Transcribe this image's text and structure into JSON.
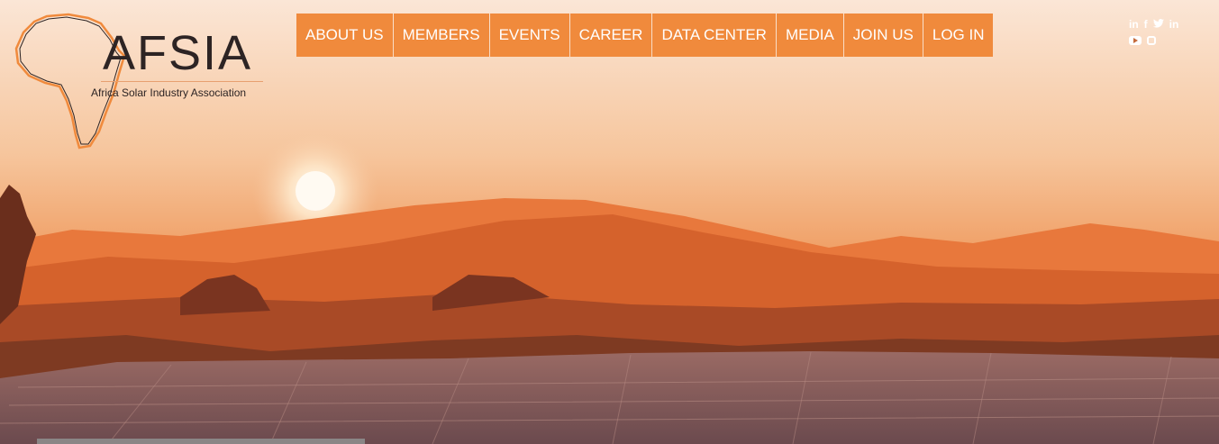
{
  "brand": {
    "name": "AFSIA",
    "tagline": "Africa Solar Industry Association"
  },
  "nav": {
    "items": [
      {
        "label": "ABOUT US"
      },
      {
        "label": "MEMBERS"
      },
      {
        "label": "EVENTS"
      },
      {
        "label": "CAREER"
      },
      {
        "label": "DATA CENTER"
      },
      {
        "label": "MEDIA"
      },
      {
        "label": "JOIN US"
      },
      {
        "label": "LOG IN"
      }
    ]
  },
  "social": {
    "row1": [
      "in",
      "f",
      "t",
      "in"
    ],
    "icons": [
      "linkedin-icon",
      "facebook-icon",
      "twitter-icon",
      "linkedin-icon",
      "youtube-icon",
      "instagram-icon"
    ]
  },
  "colors": {
    "nav_bg": "#f08a3c",
    "nav_text": "#ffffff",
    "logo_text": "#2d2424"
  }
}
